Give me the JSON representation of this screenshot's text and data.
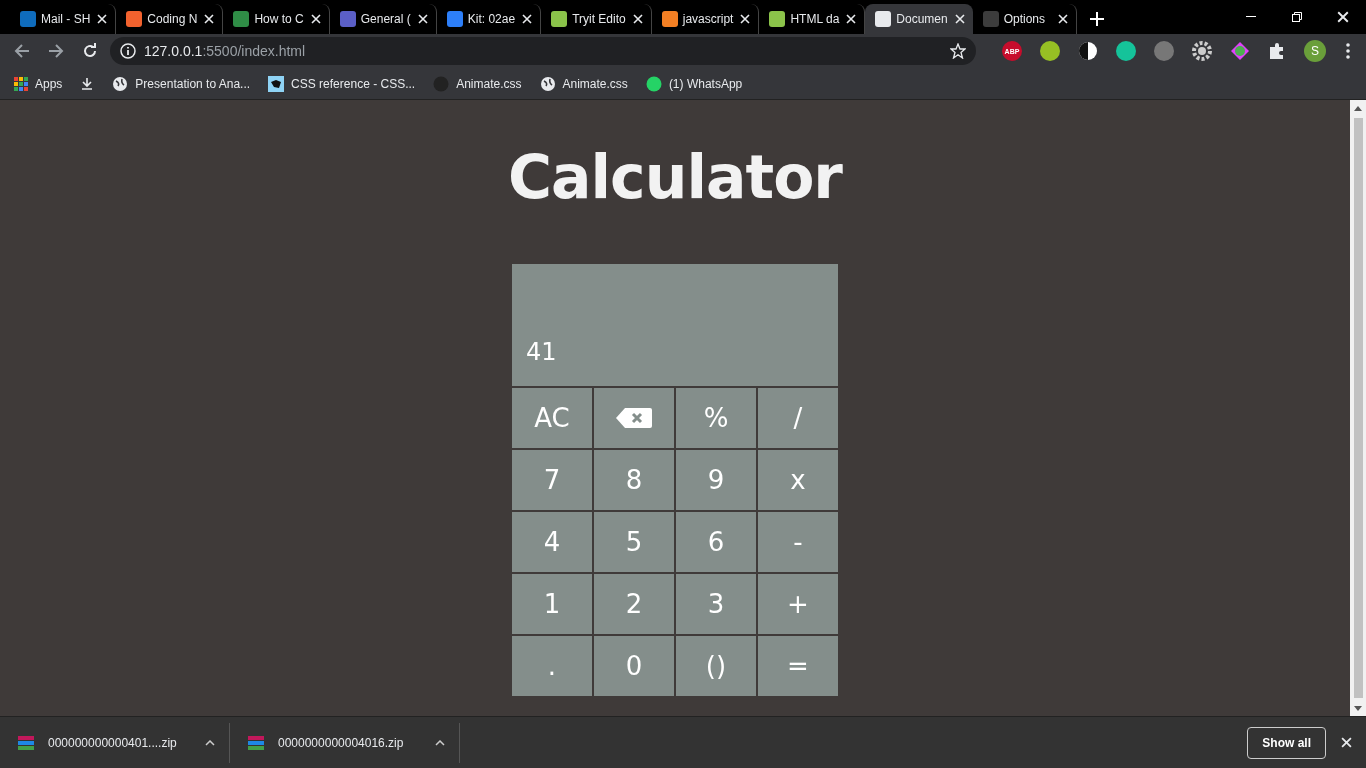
{
  "tabs": [
    {
      "title": "Mail - SH",
      "color": "#0f6cbd",
      "selected": false
    },
    {
      "title": "Coding N",
      "color": "#f2622e",
      "selected": false
    },
    {
      "title": "How to C",
      "color": "#2f8d46",
      "selected": false
    },
    {
      "title": "General (",
      "color": "#5b5fc7",
      "selected": false
    },
    {
      "title": "Kit: 02ae",
      "color": "#2d7ff9",
      "selected": false
    },
    {
      "title": "Tryit Edito",
      "color": "#8bc34a",
      "selected": false
    },
    {
      "title": "javascript",
      "color": "#f48024",
      "selected": false
    },
    {
      "title": "HTML da",
      "color": "#8bc34a",
      "selected": false
    },
    {
      "title": "Documen",
      "color": "#e8eaed",
      "selected": true
    },
    {
      "title": "Options",
      "color": "#3c3c3c",
      "selected": false
    }
  ],
  "address": {
    "host": "127.0.0.1",
    "path": ":5500/index.html"
  },
  "extensions": {
    "adblock": "ABP",
    "avatar": "S"
  },
  "bookmarks": [
    {
      "label": "Apps",
      "kind": "apps"
    },
    {
      "kind": "download"
    },
    {
      "label": "Presentation to Ana...",
      "kind": "globe"
    },
    {
      "label": "CSS reference - CSS...",
      "kind": "css"
    },
    {
      "label": "Animate.css",
      "kind": "github"
    },
    {
      "label": "Animate.css",
      "kind": "globe"
    },
    {
      "label": "(1) WhatsApp",
      "kind": "whatsapp"
    }
  ],
  "page": {
    "title": "Calculator",
    "display": "41",
    "keys": [
      {
        "label": "AC",
        "kind": "text"
      },
      {
        "kind": "backspace"
      },
      {
        "label": "%",
        "kind": "text"
      },
      {
        "label": "/",
        "kind": "text"
      },
      {
        "label": "7",
        "kind": "text"
      },
      {
        "label": "8",
        "kind": "text"
      },
      {
        "label": "9",
        "kind": "text"
      },
      {
        "label": "x",
        "kind": "text"
      },
      {
        "label": "4",
        "kind": "text"
      },
      {
        "label": "5",
        "kind": "text"
      },
      {
        "label": "6",
        "kind": "text"
      },
      {
        "label": "-",
        "kind": "text"
      },
      {
        "label": "1",
        "kind": "text"
      },
      {
        "label": "2",
        "kind": "text"
      },
      {
        "label": "3",
        "kind": "text"
      },
      {
        "label": "+",
        "kind": "text"
      },
      {
        "label": ".",
        "kind": "text"
      },
      {
        "label": "0",
        "kind": "text"
      },
      {
        "label": "()",
        "kind": "text"
      },
      {
        "label": "=",
        "kind": "text"
      }
    ]
  },
  "downloads": {
    "items": [
      {
        "name": "000000000000401....zip"
      },
      {
        "name": "0000000000004016.zip"
      }
    ],
    "show_all": "Show all"
  }
}
